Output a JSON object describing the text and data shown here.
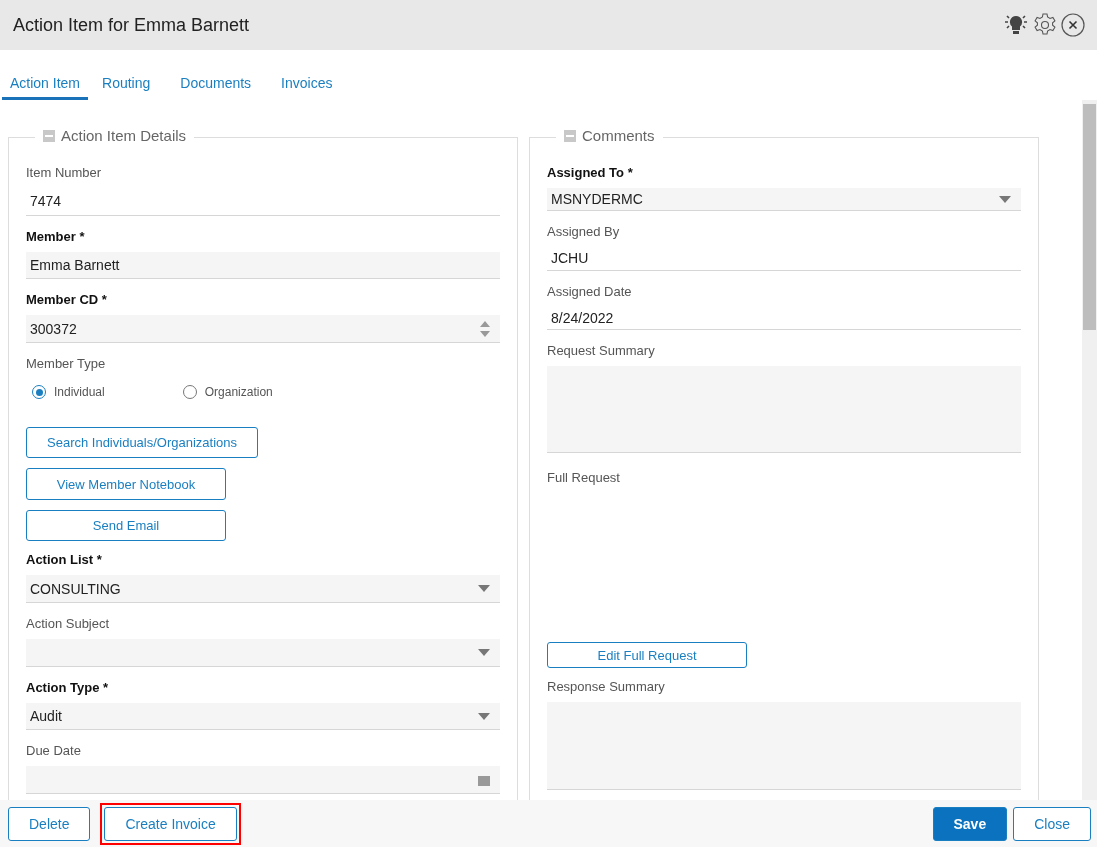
{
  "window": {
    "title": "Action Item for Emma Barnett"
  },
  "tabs": [
    {
      "label": "Action Item",
      "selected": true
    },
    {
      "label": "Routing",
      "selected": false
    },
    {
      "label": "Documents",
      "selected": false
    },
    {
      "label": "Invoices",
      "selected": false
    }
  ],
  "left_panel": {
    "title": "Action Item Details",
    "fields": [
      {
        "kind": "text",
        "label": "Item Number",
        "required": false,
        "value": "7474"
      },
      {
        "kind": "readonly",
        "label": "Member *",
        "required": true,
        "value": "Emma Barnett"
      },
      {
        "kind": "spinner",
        "label": "Member CD *",
        "required": true,
        "value": "300372"
      },
      {
        "kind": "radio",
        "label": "Member Type",
        "required": false,
        "options": [
          {
            "label": "Individual",
            "selected": true
          },
          {
            "label": "Organization",
            "selected": false
          }
        ]
      },
      {
        "kind": "button",
        "label": "Search Individuals/Organizations"
      },
      {
        "kind": "button",
        "label": "View Member Notebook"
      },
      {
        "kind": "button",
        "label": "Send Email"
      },
      {
        "kind": "select",
        "label": "Action List *",
        "required": true,
        "value": "CONSULTING"
      },
      {
        "kind": "select",
        "label": "Action Subject",
        "required": false
      },
      {
        "kind": "select",
        "label": "Action Type *",
        "required": true,
        "value": "Audit"
      },
      {
        "kind": "date",
        "label": "Due Date",
        "required": false
      }
    ]
  },
  "right_panel": {
    "title": "Comments",
    "fields": [
      {
        "kind": "select",
        "label": "Assigned To *",
        "required": true,
        "value": "MSNYDERMC"
      },
      {
        "kind": "text",
        "label": "Assigned By",
        "required": false,
        "value": "JCHU"
      },
      {
        "kind": "text",
        "label": "Assigned Date",
        "required": false,
        "value": "8/24/2022"
      },
      {
        "kind": "textarea",
        "label": "Request Summary",
        "required": false
      },
      {
        "kind": "blank",
        "label": "Full Request",
        "required": false
      },
      {
        "kind": "button",
        "label": "Edit Full Request"
      },
      {
        "kind": "textarea",
        "label": "Response Summary",
        "required": false
      }
    ]
  },
  "footer": {
    "left_buttons": [
      {
        "label": "Delete",
        "highlighted": false
      },
      {
        "label": "Create Invoice",
        "highlighted": true
      }
    ],
    "right_buttons": [
      {
        "label": "Save",
        "primary": true
      },
      {
        "label": "Close",
        "primary": false
      }
    ]
  }
}
